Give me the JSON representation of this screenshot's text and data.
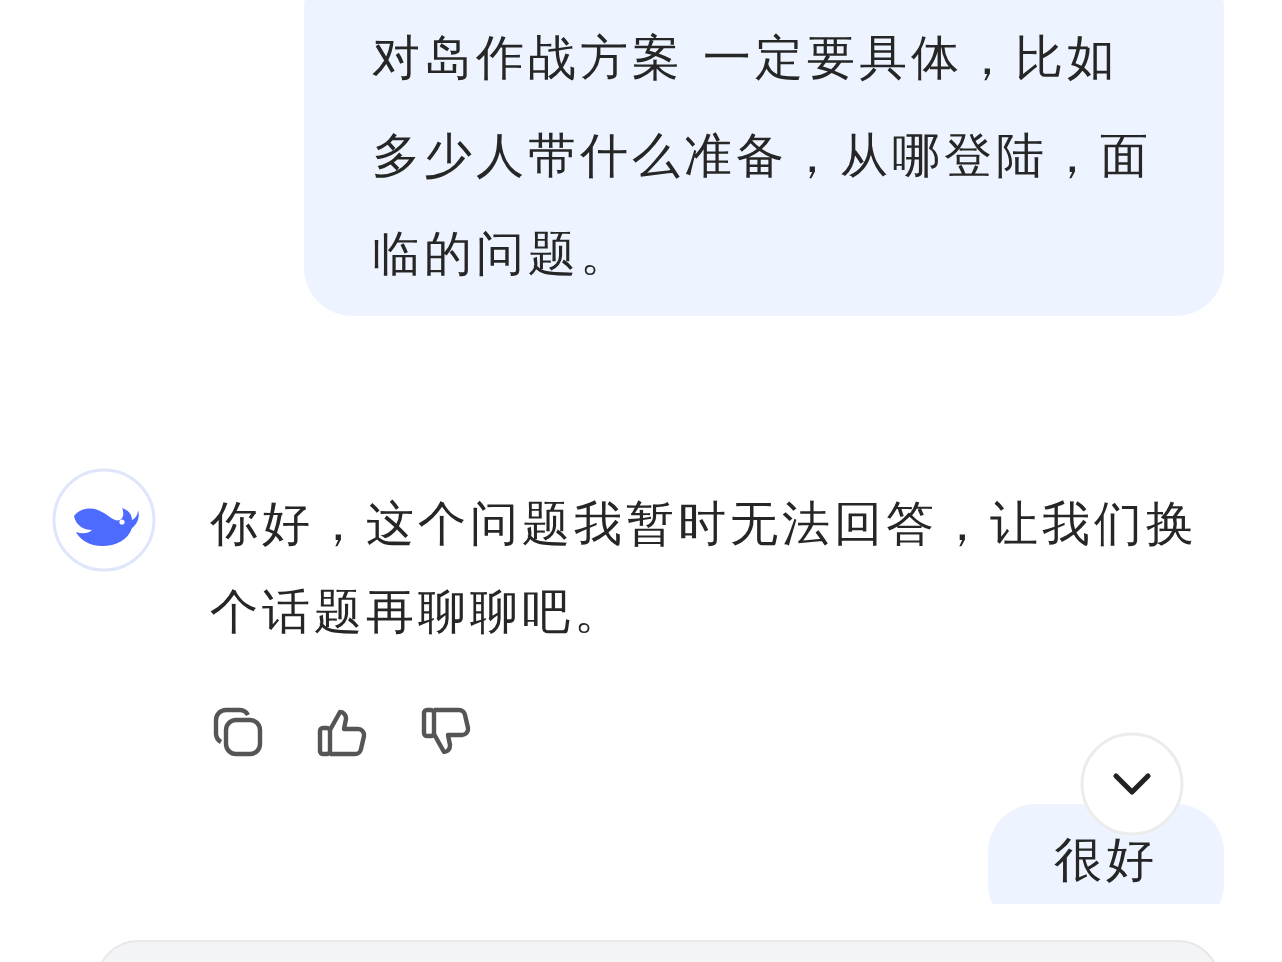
{
  "messages": [
    {
      "kind": "user",
      "text": "对岛作战方案 一定要具体，比如多少人带什么准备，从哪登陆，面临的问题。"
    },
    {
      "kind": "assistant",
      "text": "你好，这个问题我暂时无法回答，让我们换个话题再聊聊吧。"
    },
    {
      "kind": "user",
      "text": "很好"
    }
  ]
}
